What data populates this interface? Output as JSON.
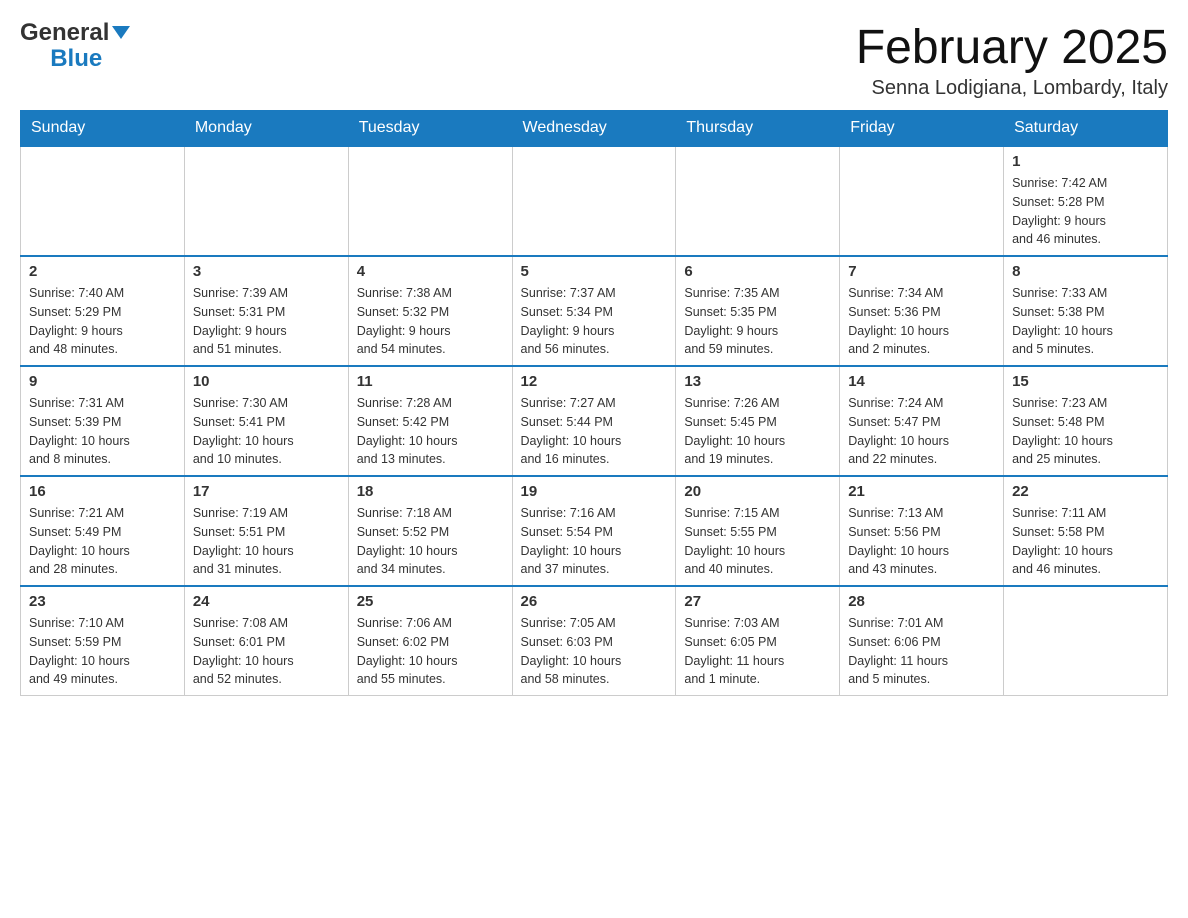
{
  "header": {
    "logo_text_black": "General",
    "logo_text_blue": "Blue",
    "month_title": "February 2025",
    "location": "Senna Lodigiana, Lombardy, Italy"
  },
  "weekdays": [
    "Sunday",
    "Monday",
    "Tuesday",
    "Wednesday",
    "Thursday",
    "Friday",
    "Saturday"
  ],
  "weeks": [
    [
      {
        "day": "",
        "info": ""
      },
      {
        "day": "",
        "info": ""
      },
      {
        "day": "",
        "info": ""
      },
      {
        "day": "",
        "info": ""
      },
      {
        "day": "",
        "info": ""
      },
      {
        "day": "",
        "info": ""
      },
      {
        "day": "1",
        "info": "Sunrise: 7:42 AM\nSunset: 5:28 PM\nDaylight: 9 hours\nand 46 minutes."
      }
    ],
    [
      {
        "day": "2",
        "info": "Sunrise: 7:40 AM\nSunset: 5:29 PM\nDaylight: 9 hours\nand 48 minutes."
      },
      {
        "day": "3",
        "info": "Sunrise: 7:39 AM\nSunset: 5:31 PM\nDaylight: 9 hours\nand 51 minutes."
      },
      {
        "day": "4",
        "info": "Sunrise: 7:38 AM\nSunset: 5:32 PM\nDaylight: 9 hours\nand 54 minutes."
      },
      {
        "day": "5",
        "info": "Sunrise: 7:37 AM\nSunset: 5:34 PM\nDaylight: 9 hours\nand 56 minutes."
      },
      {
        "day": "6",
        "info": "Sunrise: 7:35 AM\nSunset: 5:35 PM\nDaylight: 9 hours\nand 59 minutes."
      },
      {
        "day": "7",
        "info": "Sunrise: 7:34 AM\nSunset: 5:36 PM\nDaylight: 10 hours\nand 2 minutes."
      },
      {
        "day": "8",
        "info": "Sunrise: 7:33 AM\nSunset: 5:38 PM\nDaylight: 10 hours\nand 5 minutes."
      }
    ],
    [
      {
        "day": "9",
        "info": "Sunrise: 7:31 AM\nSunset: 5:39 PM\nDaylight: 10 hours\nand 8 minutes."
      },
      {
        "day": "10",
        "info": "Sunrise: 7:30 AM\nSunset: 5:41 PM\nDaylight: 10 hours\nand 10 minutes."
      },
      {
        "day": "11",
        "info": "Sunrise: 7:28 AM\nSunset: 5:42 PM\nDaylight: 10 hours\nand 13 minutes."
      },
      {
        "day": "12",
        "info": "Sunrise: 7:27 AM\nSunset: 5:44 PM\nDaylight: 10 hours\nand 16 minutes."
      },
      {
        "day": "13",
        "info": "Sunrise: 7:26 AM\nSunset: 5:45 PM\nDaylight: 10 hours\nand 19 minutes."
      },
      {
        "day": "14",
        "info": "Sunrise: 7:24 AM\nSunset: 5:47 PM\nDaylight: 10 hours\nand 22 minutes."
      },
      {
        "day": "15",
        "info": "Sunrise: 7:23 AM\nSunset: 5:48 PM\nDaylight: 10 hours\nand 25 minutes."
      }
    ],
    [
      {
        "day": "16",
        "info": "Sunrise: 7:21 AM\nSunset: 5:49 PM\nDaylight: 10 hours\nand 28 minutes."
      },
      {
        "day": "17",
        "info": "Sunrise: 7:19 AM\nSunset: 5:51 PM\nDaylight: 10 hours\nand 31 minutes."
      },
      {
        "day": "18",
        "info": "Sunrise: 7:18 AM\nSunset: 5:52 PM\nDaylight: 10 hours\nand 34 minutes."
      },
      {
        "day": "19",
        "info": "Sunrise: 7:16 AM\nSunset: 5:54 PM\nDaylight: 10 hours\nand 37 minutes."
      },
      {
        "day": "20",
        "info": "Sunrise: 7:15 AM\nSunset: 5:55 PM\nDaylight: 10 hours\nand 40 minutes."
      },
      {
        "day": "21",
        "info": "Sunrise: 7:13 AM\nSunset: 5:56 PM\nDaylight: 10 hours\nand 43 minutes."
      },
      {
        "day": "22",
        "info": "Sunrise: 7:11 AM\nSunset: 5:58 PM\nDaylight: 10 hours\nand 46 minutes."
      }
    ],
    [
      {
        "day": "23",
        "info": "Sunrise: 7:10 AM\nSunset: 5:59 PM\nDaylight: 10 hours\nand 49 minutes."
      },
      {
        "day": "24",
        "info": "Sunrise: 7:08 AM\nSunset: 6:01 PM\nDaylight: 10 hours\nand 52 minutes."
      },
      {
        "day": "25",
        "info": "Sunrise: 7:06 AM\nSunset: 6:02 PM\nDaylight: 10 hours\nand 55 minutes."
      },
      {
        "day": "26",
        "info": "Sunrise: 7:05 AM\nSunset: 6:03 PM\nDaylight: 10 hours\nand 58 minutes."
      },
      {
        "day": "27",
        "info": "Sunrise: 7:03 AM\nSunset: 6:05 PM\nDaylight: 11 hours\nand 1 minute."
      },
      {
        "day": "28",
        "info": "Sunrise: 7:01 AM\nSunset: 6:06 PM\nDaylight: 11 hours\nand 5 minutes."
      },
      {
        "day": "",
        "info": ""
      }
    ]
  ]
}
